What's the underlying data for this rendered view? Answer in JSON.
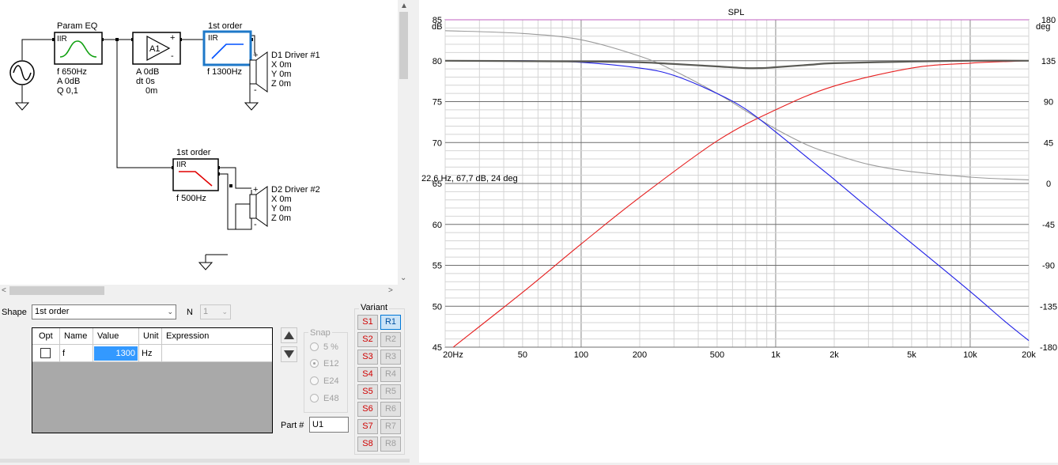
{
  "schematic": {
    "param_eq": {
      "title": "Param EQ",
      "type": "IIR",
      "f": "f   650Hz",
      "a": "A  0dB",
      "q": "Q  0,1"
    },
    "amp": {
      "name": "A1",
      "plus": "+",
      "minus": "-",
      "a": "A  0dB",
      "dt": "dt 0s",
      "dist": "0m"
    },
    "filter1": {
      "title": "1st order",
      "type": "IIR",
      "f": "f   1300Hz"
    },
    "filter2": {
      "title": "1st order",
      "type": "IIR",
      "f": "f   500Hz"
    },
    "driver1": {
      "name": "D1 Driver #1",
      "x": "X 0m",
      "y": "Y 0m",
      "z": "Z 0m"
    },
    "driver2": {
      "name": "D2 Driver #2",
      "x": "X 0m",
      "y": "Y 0m",
      "z": "Z 0m"
    },
    "plus": "+",
    "minus": "-"
  },
  "props": {
    "shape_label": "Shape",
    "shape_value": "1st order",
    "n_label": "N",
    "n_value": "1",
    "columns": [
      "Opt",
      "Name",
      "Value",
      "Unit",
      "Expression"
    ],
    "row": {
      "name": "f",
      "value": "1300",
      "unit": "Hz",
      "expression": ""
    },
    "snap_label": "Snap",
    "snap_options": [
      "5 %",
      "E12",
      "E24",
      "E48"
    ],
    "snap_selected": "E12",
    "part_label": "Part #",
    "part_value": "U1"
  },
  "variant": {
    "label": "Variant",
    "rows": [
      [
        "S1",
        "R1"
      ],
      [
        "S2",
        "R2"
      ],
      [
        "S3",
        "R3"
      ],
      [
        "S4",
        "R4"
      ],
      [
        "S5",
        "R5"
      ],
      [
        "S6",
        "R6"
      ],
      [
        "S7",
        "R7"
      ],
      [
        "S8",
        "R8"
      ]
    ],
    "selected": "R1"
  },
  "graph": {
    "title": "SPL",
    "left_unit": "dB",
    "right_unit": "deg",
    "cursor_readout": "22,6 Hz, 67,7 dB, 24 deg"
  },
  "colors": {
    "driver1": "#1f1fe6",
    "driver2": "#e61f1f",
    "sum": "#5a5a55",
    "phase": "#9a9a9a",
    "filter_blue": "#0050ff",
    "filter_red": "#e00000",
    "eq_green": "#10a010",
    "selected_block": "#1e78c8"
  },
  "chart_data": {
    "type": "line",
    "title": "SPL",
    "xscale": "log",
    "xlim": [
      20,
      20000
    ],
    "ylim": [
      45,
      85
    ],
    "y2lim": [
      -180,
      180
    ],
    "xticks": [
      {
        "v": 20,
        "label": "20Hz"
      },
      {
        "v": 50,
        "label": "50"
      },
      {
        "v": 100,
        "label": "100"
      },
      {
        "v": 200,
        "label": "200"
      },
      {
        "v": 500,
        "label": "500"
      },
      {
        "v": 1000,
        "label": "1k"
      },
      {
        "v": 2000,
        "label": "2k"
      },
      {
        "v": 5000,
        "label": "5k"
      },
      {
        "v": 10000,
        "label": "10k"
      },
      {
        "v": 20000,
        "label": "20k"
      }
    ],
    "yticks": [
      {
        "v": 85,
        "label": "85"
      },
      {
        "v": 80,
        "label": "80"
      },
      {
        "v": 75,
        "label": "75"
      },
      {
        "v": 70,
        "label": "70"
      },
      {
        "v": 65,
        "label": "65"
      },
      {
        "v": 60,
        "label": "60"
      },
      {
        "v": 55,
        "label": "55"
      },
      {
        "v": 50,
        "label": "50"
      },
      {
        "v": 45,
        "label": "45"
      }
    ],
    "y2ticks": [
      {
        "v": 180,
        "label": "180"
      },
      {
        "v": 135,
        "label": "135"
      },
      {
        "v": 90,
        "label": "90"
      },
      {
        "v": 45,
        "label": "45"
      },
      {
        "v": 0,
        "label": "0"
      },
      {
        "v": -45,
        "label": "-45"
      },
      {
        "v": -90,
        "label": "-90"
      },
      {
        "v": -135,
        "label": "-135"
      },
      {
        "v": -180,
        "label": "-180"
      }
    ],
    "grid": true,
    "series": [
      {
        "color": "#1f1fe6",
        "axis": "left",
        "x": [
          20,
          50,
          100,
          200,
          300,
          500,
          700,
          1000,
          1500,
          2000,
          3000,
          5000,
          10000,
          15000,
          20000
        ],
        "values": [
          80.0,
          80.0,
          79.8,
          79.1,
          78.2,
          76.0,
          74.1,
          71.3,
          67.9,
          65.5,
          62.0,
          57.7,
          51.8,
          48.2,
          45.8
        ]
      },
      {
        "color": "#e61f1f",
        "axis": "left",
        "x": [
          22,
          50,
          100,
          200,
          500,
          1000,
          2000,
          5000,
          10000,
          20000
        ],
        "values": [
          45,
          51.7,
          57.6,
          63.3,
          70.2,
          74.0,
          76.9,
          79.1,
          79.7,
          80.0
        ]
      },
      {
        "color": "#5a5a55",
        "axis": "left",
        "x": [
          20,
          100,
          200,
          300,
          500,
          700,
          850,
          1000,
          1500,
          2000,
          5000,
          10000,
          20000
        ],
        "values": [
          80.0,
          79.9,
          79.8,
          79.6,
          79.3,
          79.1,
          79.1,
          79.2,
          79.5,
          79.7,
          79.9,
          80.0,
          80.0
        ]
      },
      {
        "color": "#9a9a9a",
        "axis": "right",
        "x": [
          20,
          50,
          100,
          200,
          300,
          500,
          700,
          1000,
          1500,
          2000,
          3000,
          5000,
          10000,
          15000,
          20000
        ],
        "values": [
          168,
          165,
          158,
          140,
          124,
          99,
          80,
          60,
          41,
          32,
          21,
          13,
          7,
          5,
          4
        ]
      }
    ]
  }
}
